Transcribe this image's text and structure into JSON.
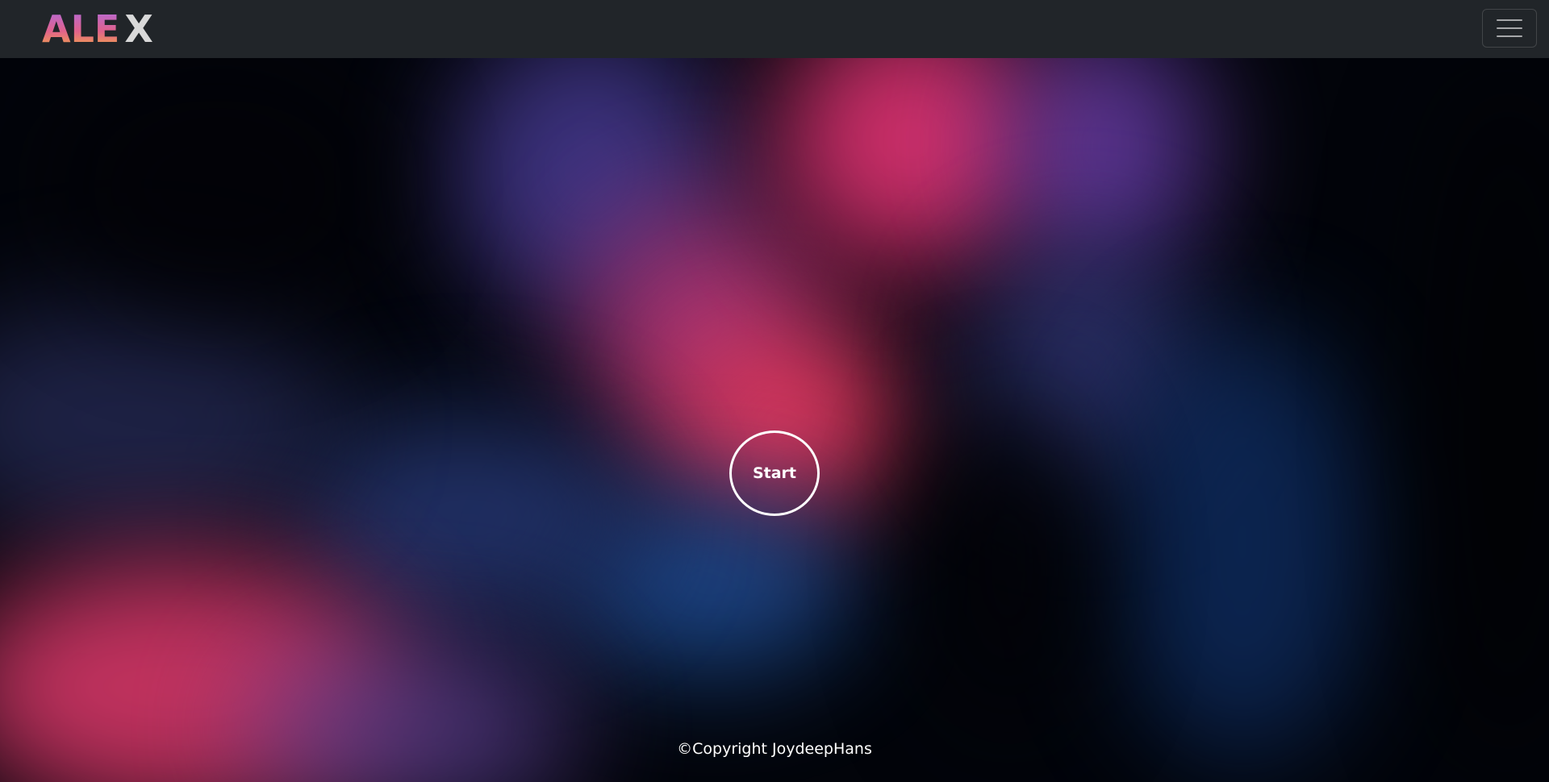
{
  "navbar": {
    "logo_part1": "ALE",
    "logo_part2": "X",
    "menu_icon": "hamburger-menu-icon",
    "background": "#212529"
  },
  "hero": {
    "start_label": "Start"
  },
  "footer": {
    "copyright": "©Copyright JoydeepHans"
  },
  "colors": {
    "pink": "#f23c73",
    "purple": "#7a46b8",
    "blue": "#1f4f9a",
    "dark": "#02040a"
  }
}
